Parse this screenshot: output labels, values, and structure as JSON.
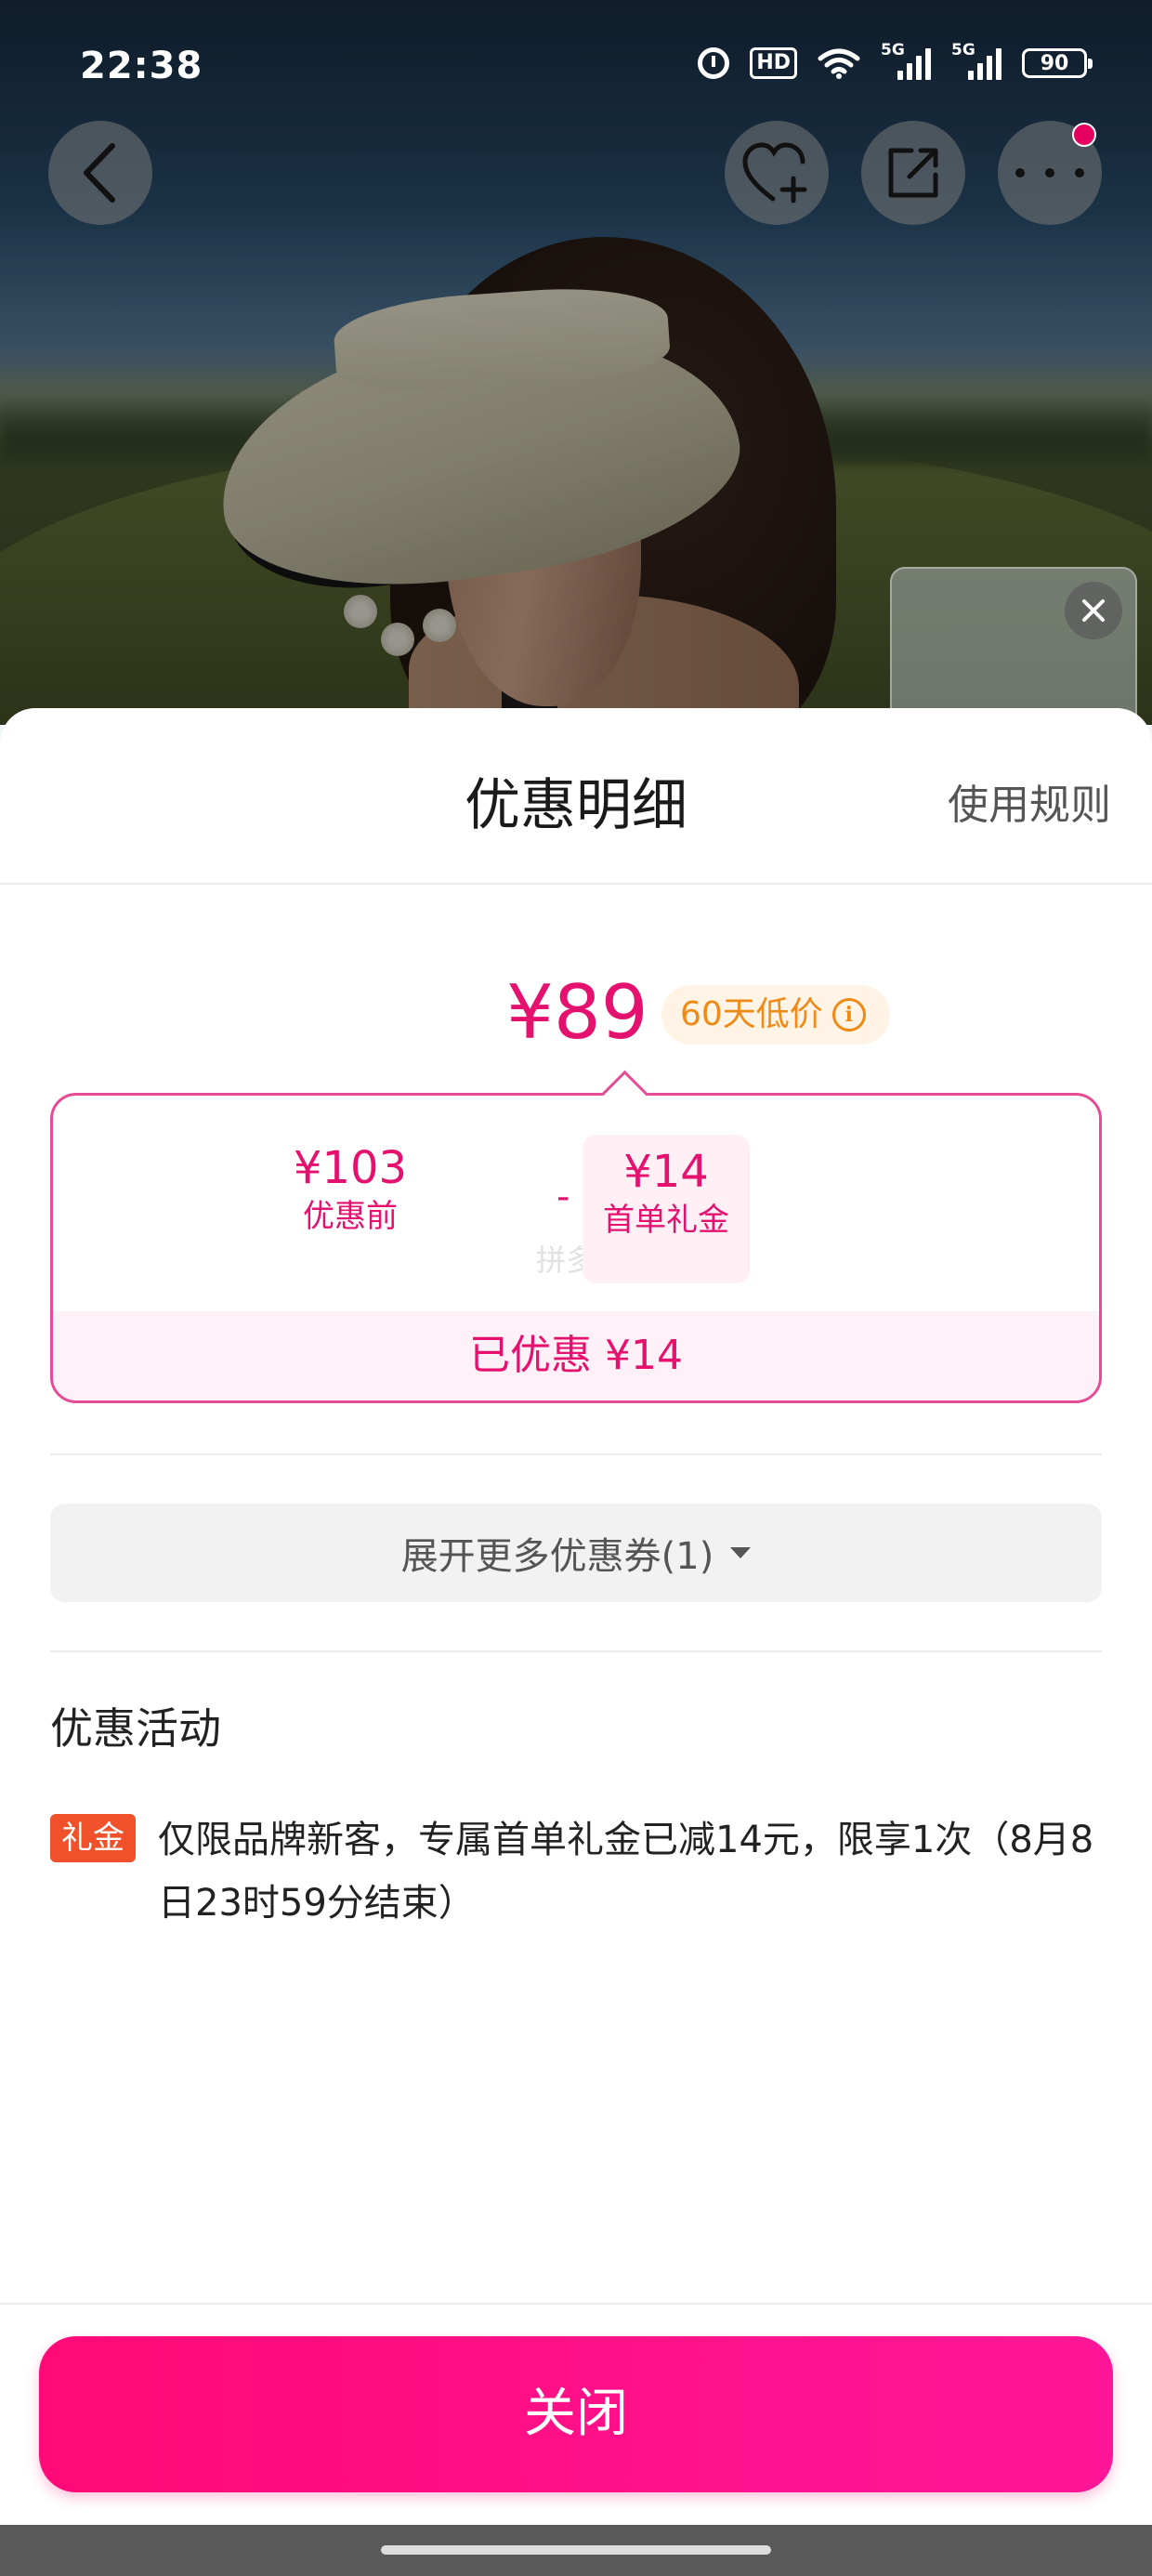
{
  "status_bar": {
    "time": "22:38",
    "hd_label": "HD",
    "signal1_label": "5G",
    "signal2_label": "5G",
    "battery": "90"
  },
  "top_actions": {
    "back_icon": "chevron-left-icon",
    "favorite_icon": "heart-plus-icon",
    "share_icon": "share-icon",
    "more_icon": "more-icon"
  },
  "sheet": {
    "title": "优惠明细",
    "rules_link": "使用规则",
    "final_price": "¥89",
    "low_price_tag": "60天低价",
    "breakdown": {
      "original_amount": "¥103",
      "original_label": "优惠前",
      "minus": "-",
      "coupon_amount": "¥14",
      "coupon_label": "首单礼金",
      "watermark": "拼多多",
      "saved_text": "已优惠 ¥14"
    },
    "expand_button": "展开更多优惠券(1)",
    "activities_title": "优惠活动",
    "activity": {
      "tag": "礼金",
      "text": "仅限品牌新客，专属首单礼金已减14元，限享1次（8月8日23时59分结束）"
    },
    "close_button": "关闭"
  },
  "colors": {
    "accent": "#e4126e",
    "button": "#ff0a77",
    "tag_orange": "#f08a16",
    "promo_tag": "#f0512a"
  }
}
